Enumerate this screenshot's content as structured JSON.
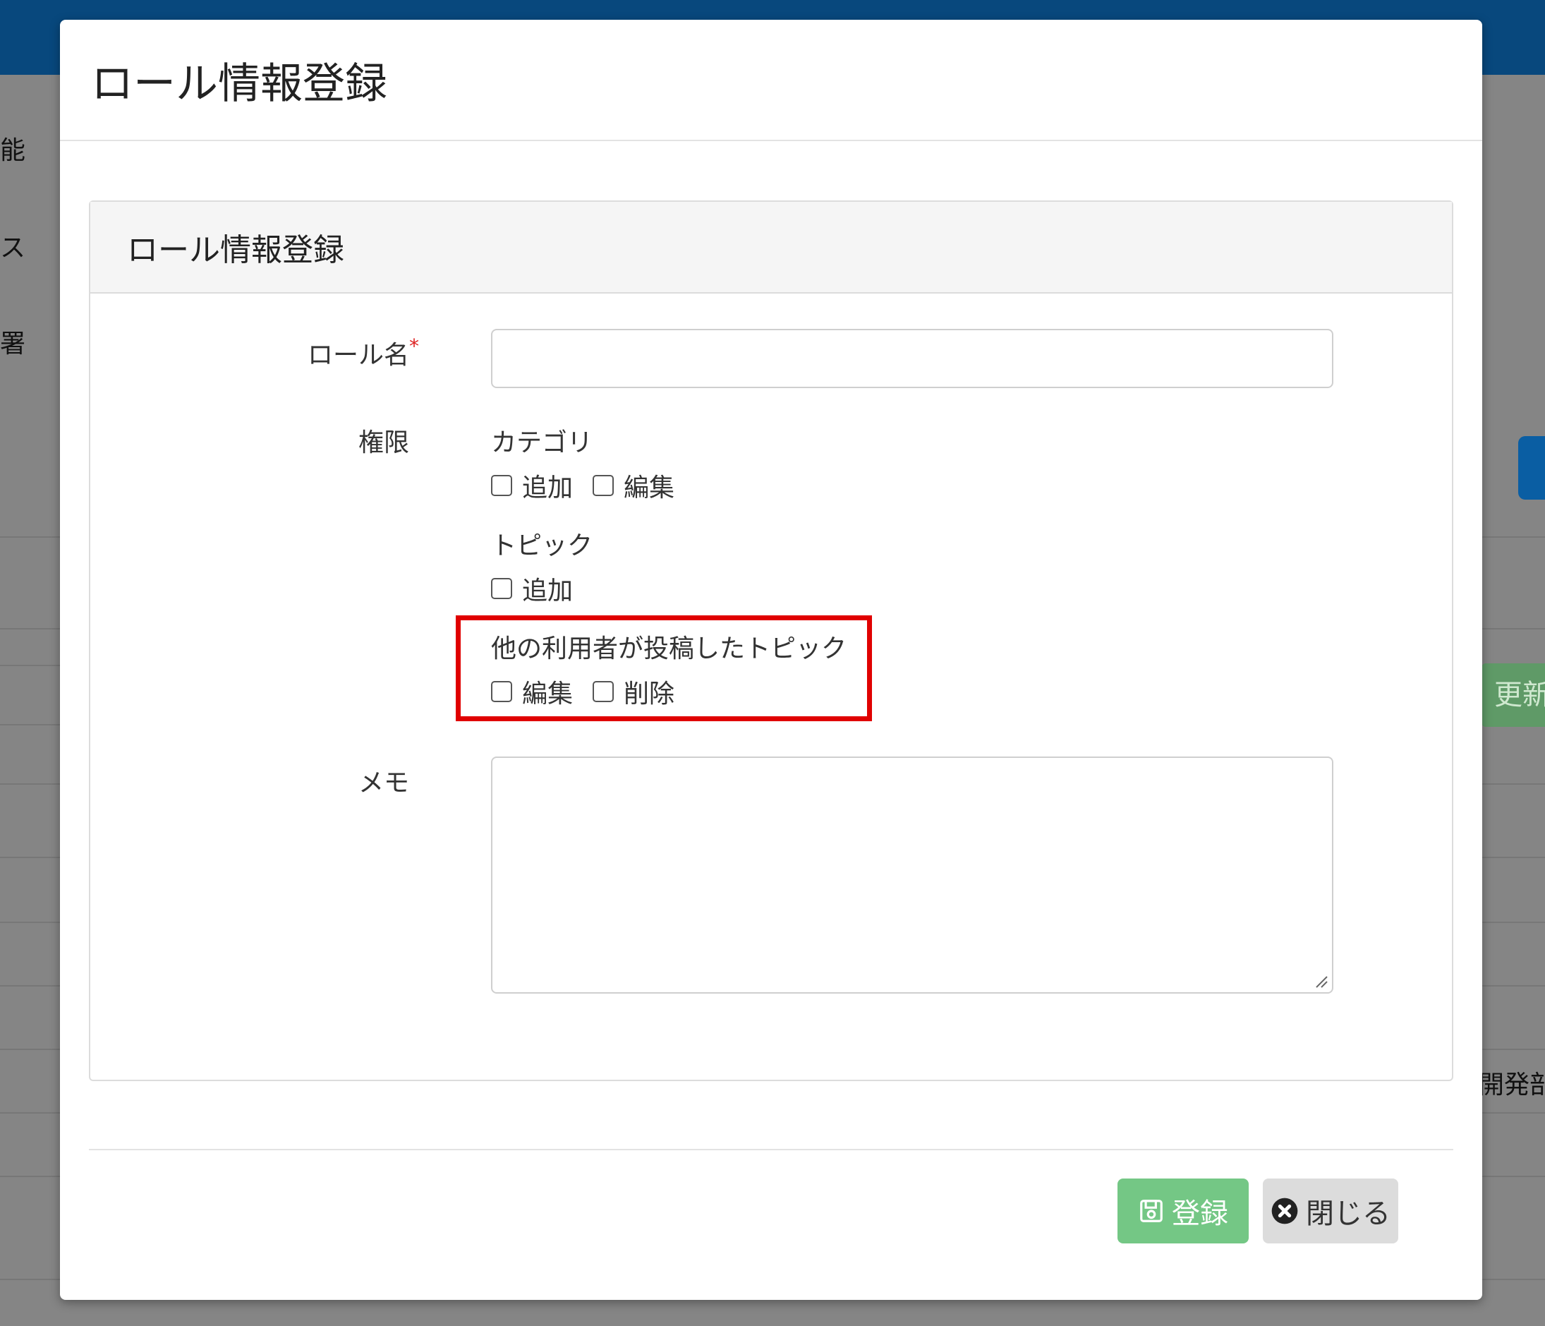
{
  "background": {
    "side_labels": [
      "能",
      "ス",
      "署"
    ],
    "right_button_label": "更新",
    "right_text": "開発部"
  },
  "modal": {
    "title": "ロール情報登録",
    "card_title": "ロール情報登録",
    "role_name": {
      "label": "ロール名",
      "required_mark": "*",
      "value": "",
      "placeholder": ""
    },
    "permissions": {
      "label": "権限",
      "groups": [
        {
          "title": "カテゴリ",
          "options": [
            {
              "label": "追加",
              "checked": false
            },
            {
              "label": "編集",
              "checked": false
            }
          ]
        },
        {
          "title": "トピック",
          "options": [
            {
              "label": "追加",
              "checked": false
            }
          ]
        },
        {
          "title": "他の利用者が投稿したトピック",
          "highlighted": true,
          "options": [
            {
              "label": "編集",
              "checked": false
            },
            {
              "label": "削除",
              "checked": false
            }
          ]
        }
      ]
    },
    "memo": {
      "label": "メモ",
      "value": ""
    },
    "footer": {
      "save_label": "登録",
      "close_label": "閉じる"
    }
  },
  "colors": {
    "header": "#08487d",
    "save_button": "#74c785",
    "close_button": "#dcdcdc",
    "highlight": "#e00000",
    "required": "#dd2222"
  }
}
